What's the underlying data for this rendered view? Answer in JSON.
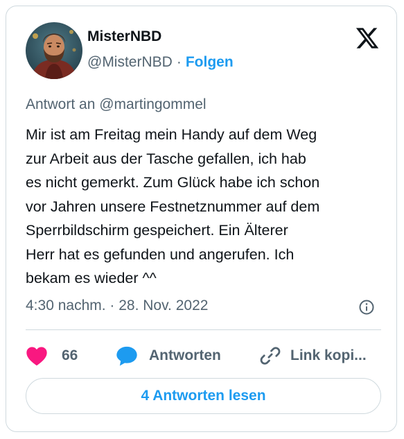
{
  "author": {
    "display_name": "MisterNBD",
    "handle": "@MisterNBD",
    "separator": "·",
    "follow_label": "Folgen",
    "avatar_icon": "bearded-man-portrait-avatar"
  },
  "platform_icon": "x-logo-icon",
  "tweet": {
    "reply_to": "Antwort an @martingommel",
    "text": "Mir ist am Freitag mein Handy auf dem Weg\nzur Arbeit aus der Tasche gefallen, ich hab\nes nicht gemerkt. Zum Glück habe ich schon\nvor Jahren unsere Festnetznummer auf dem\nSperrbildschirm gespeichert. Ein Älterer\nHerr hat es gefunden und angerufen. Ich\nbekam es wieder ^^",
    "timestamp": "4:30 nachm. · 28. Nov. 2022"
  },
  "actions": {
    "like_count": "66",
    "reply_label": "Antworten",
    "copy_link_label": "Link kopi..."
  },
  "read_replies_label": "4 Antworten lesen",
  "colors": {
    "accent": "#1d9bf0",
    "like": "#f91880",
    "secondary_text": "#536471",
    "primary_text": "#0f1419",
    "border": "#cfd9de"
  }
}
